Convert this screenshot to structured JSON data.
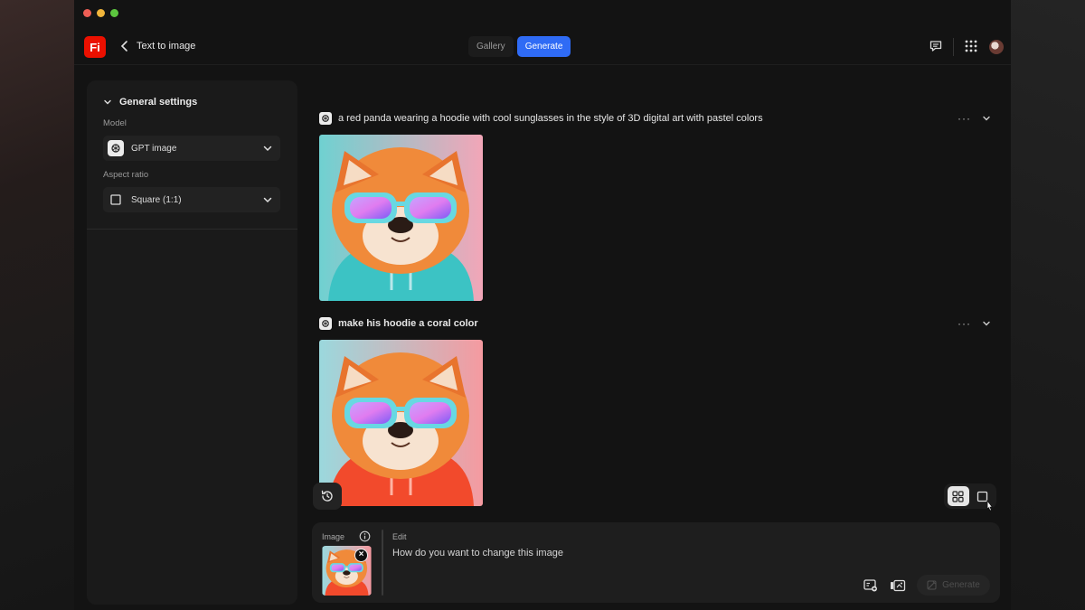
{
  "app": {
    "title": "Text to image",
    "logo_text": "Fi",
    "brand_color": "#eb1000",
    "accent_color": "#2f6bf5"
  },
  "header": {
    "tabs": [
      {
        "label": "Gallery",
        "active": false
      },
      {
        "label": "Generate",
        "active": true
      }
    ],
    "icons": [
      "feedback-icon",
      "apps-grid-icon",
      "avatar"
    ]
  },
  "sidebar": {
    "section_title": "General settings",
    "model_label": "Model",
    "model_value": "GPT image",
    "aspect_label": "Aspect ratio",
    "aspect_value": "Square (1:1)"
  },
  "feed": [
    {
      "prompt": "a red panda wearing a hoodie with cool sunglasses in the style of 3D digital art with pastel colors",
      "hoodie_color": "#3cc3c4"
    },
    {
      "prompt": "make his hoodie a coral color",
      "hoodie_color": "#f24a2c"
    }
  ],
  "composer": {
    "image_label": "Image",
    "edit_label": "Edit",
    "placeholder": "How do you want to change this image",
    "generate_label": "Generate"
  }
}
